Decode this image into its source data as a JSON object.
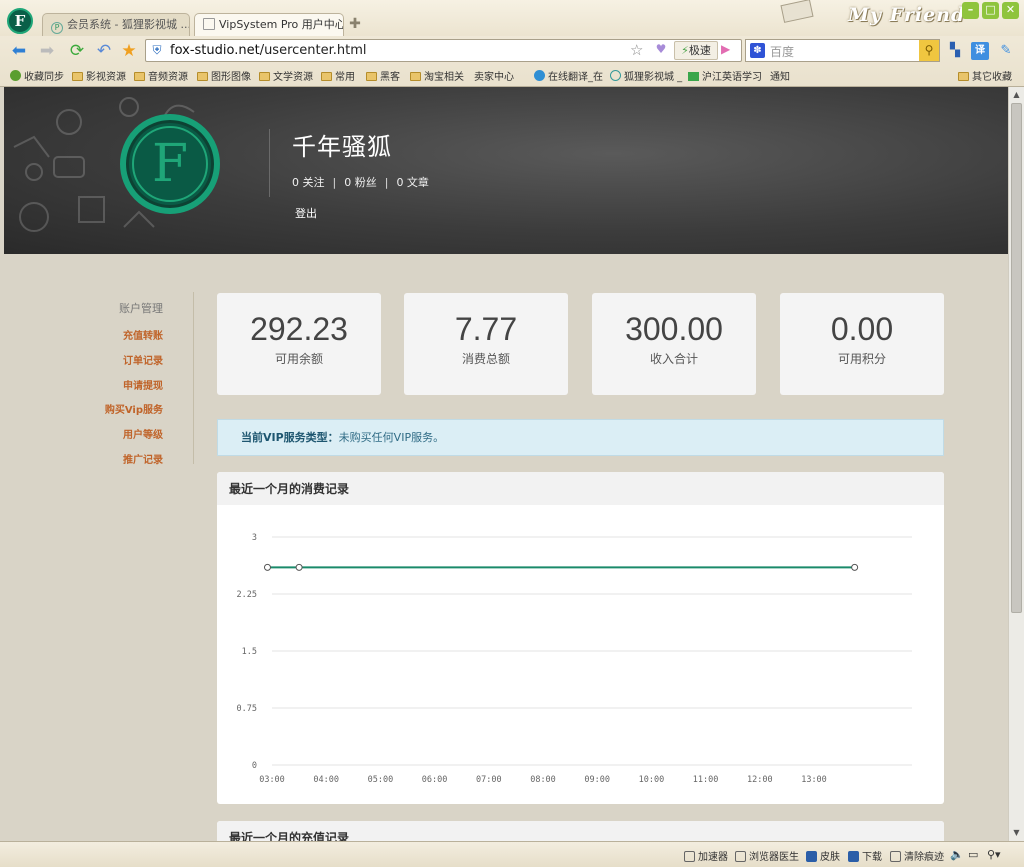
{
  "browser": {
    "tabs": [
      {
        "label": "会员系统 - 狐狸影视城 ...",
        "active": false
      },
      {
        "label": "VipSystem Pro 用户中心",
        "active": true
      }
    ],
    "skin_text": "My Friend",
    "url_domain": "fox-studio.net",
    "url_path": "/usercenter.html",
    "speed_label": "极速",
    "search_placeholder": "百度",
    "bookmarks": [
      "收藏同步",
      "影视资源",
      "音频资源",
      "图形图像",
      "文学资源",
      "常用",
      "黑客",
      "淘宝相关",
      "卖家中心",
      "在线翻译_在",
      "狐狸影视城 _",
      "沪江英语学习",
      "通知",
      "其它收藏"
    ],
    "status": {
      "accelerator": "加速器",
      "doctor": "浏览器医生",
      "skin": "皮肤",
      "download": "下载",
      "clear": "清除痕迹"
    }
  },
  "profile": {
    "logo_letter": "F",
    "name": "千年骚狐",
    "follow": "0 关注",
    "fans": "0 粉丝",
    "articles": "0 文章",
    "separator": "|",
    "logout": "登出"
  },
  "sidebar": {
    "title": "账户管理",
    "items": [
      "充值转账",
      "订单记录",
      "申请提现",
      "购买Vip服务",
      "用户等级",
      "推广记录"
    ]
  },
  "stats": [
    {
      "value": "292.23",
      "label": "可用余额"
    },
    {
      "value": "7.77",
      "label": "消费总额"
    },
    {
      "value": "300.00",
      "label": "收入合计"
    },
    {
      "value": "0.00",
      "label": "可用积分"
    }
  ],
  "vip": {
    "label": "当前VIP服务类型：",
    "value": "未购买任何VIP服务。"
  },
  "panels": {
    "consumption_title": "最近一个月的消费记录",
    "recharge_title": "最近一个月的充值记录"
  },
  "chart_data": {
    "type": "line",
    "title": "最近一个月的消费记录",
    "xlabel": "",
    "ylabel": "",
    "x_ticks": [
      "03:00",
      "04:00",
      "05:00",
      "06:00",
      "07:00",
      "08:00",
      "09:00",
      "10:00",
      "11:00",
      "12:00",
      "13:00"
    ],
    "y_ticks": [
      "0",
      "0.75",
      "1.5",
      "2.25",
      "3"
    ],
    "ylim": [
      0,
      3
    ],
    "xlim_hours": [
      3.0,
      13.0
    ],
    "series": [
      {
        "color": "#1a8a6a",
        "points": [
          {
            "x": "02:55",
            "y": 2.6
          },
          {
            "x": "03:30",
            "y": 2.6
          },
          {
            "x": "13:45",
            "y": 2.6
          }
        ]
      }
    ],
    "grid": true
  }
}
